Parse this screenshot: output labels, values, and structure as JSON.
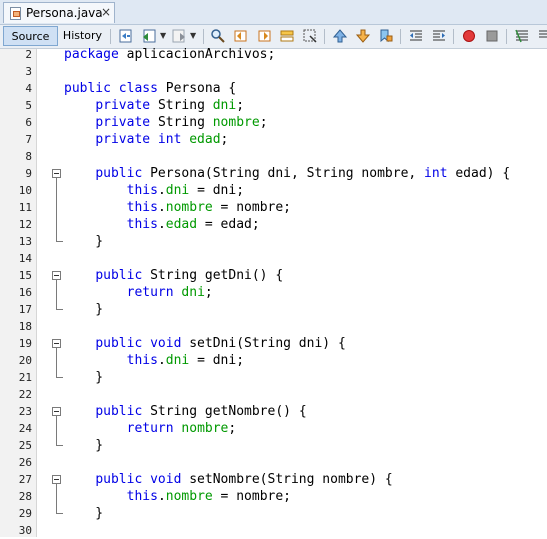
{
  "tab": {
    "title": "Persona.java",
    "close": "×",
    "icon": "java-file-icon"
  },
  "toolbar": {
    "source_label": "Source",
    "history_label": "History",
    "icons": [
      "last-edit-icon",
      "back-icon",
      "forward-icon",
      "find-icon",
      "find-previous-icon",
      "find-next-icon",
      "toggle-highlight-icon",
      "find-selection-icon",
      "previous-bookmark-icon",
      "next-bookmark-icon",
      "toggle-bookmark-icon",
      "shift-left-icon",
      "shift-right-icon",
      "record-macro-icon",
      "stop-macro-icon",
      "comment-icon"
    ]
  },
  "colors": {
    "keyword": "#0000e6",
    "field": "#009900",
    "text": "#000000"
  },
  "lines": [
    {
      "n": "2",
      "tokens": [
        [
          "package ",
          "kw"
        ],
        [
          "aplicacionArchivos;",
          ""
        ]
      ]
    },
    {
      "n": "3",
      "tokens": []
    },
    {
      "n": "4",
      "tokens": [
        [
          "public class ",
          "kw"
        ],
        [
          "Persona {",
          ""
        ]
      ]
    },
    {
      "n": "5",
      "tokens": [
        [
          "    ",
          ""
        ],
        [
          "private ",
          "kw"
        ],
        [
          "String ",
          ""
        ],
        [
          "dni",
          "fd"
        ],
        [
          ";",
          ""
        ]
      ]
    },
    {
      "n": "6",
      "tokens": [
        [
          "    ",
          ""
        ],
        [
          "private ",
          "kw"
        ],
        [
          "String ",
          ""
        ],
        [
          "nombre",
          "fd"
        ],
        [
          ";",
          ""
        ]
      ]
    },
    {
      "n": "7",
      "tokens": [
        [
          "    ",
          ""
        ],
        [
          "private int ",
          "kw"
        ],
        [
          "edad",
          "fd"
        ],
        [
          ";",
          ""
        ]
      ]
    },
    {
      "n": "8",
      "tokens": []
    },
    {
      "n": "9",
      "tokens": [
        [
          "    ",
          ""
        ],
        [
          "public ",
          "kw"
        ],
        [
          "Persona(String dni, String nombre, ",
          ""
        ],
        [
          "int ",
          "kw"
        ],
        [
          "edad) {",
          ""
        ]
      ]
    },
    {
      "n": "10",
      "tokens": [
        [
          "        ",
          ""
        ],
        [
          "this",
          "kw"
        ],
        [
          ".",
          ""
        ],
        [
          "dni",
          "fd"
        ],
        [
          " = dni;",
          ""
        ]
      ]
    },
    {
      "n": "11",
      "tokens": [
        [
          "        ",
          ""
        ],
        [
          "this",
          "kw"
        ],
        [
          ".",
          ""
        ],
        [
          "nombre",
          "fd"
        ],
        [
          " = nombre;",
          ""
        ]
      ]
    },
    {
      "n": "12",
      "tokens": [
        [
          "        ",
          ""
        ],
        [
          "this",
          "kw"
        ],
        [
          ".",
          ""
        ],
        [
          "edad",
          "fd"
        ],
        [
          " = edad;",
          ""
        ]
      ]
    },
    {
      "n": "13",
      "tokens": [
        [
          "    }",
          ""
        ]
      ]
    },
    {
      "n": "14",
      "tokens": []
    },
    {
      "n": "15",
      "tokens": [
        [
          "    ",
          ""
        ],
        [
          "public ",
          "kw"
        ],
        [
          "String getDni() {",
          ""
        ]
      ]
    },
    {
      "n": "16",
      "tokens": [
        [
          "        ",
          ""
        ],
        [
          "return ",
          "kw"
        ],
        [
          "dni",
          "fd"
        ],
        [
          ";",
          ""
        ]
      ]
    },
    {
      "n": "17",
      "tokens": [
        [
          "    }",
          ""
        ]
      ]
    },
    {
      "n": "18",
      "tokens": []
    },
    {
      "n": "19",
      "tokens": [
        [
          "    ",
          ""
        ],
        [
          "public void ",
          "kw"
        ],
        [
          "setDni(String dni) {",
          ""
        ]
      ]
    },
    {
      "n": "20",
      "tokens": [
        [
          "        ",
          ""
        ],
        [
          "this",
          "kw"
        ],
        [
          ".",
          ""
        ],
        [
          "dni",
          "fd"
        ],
        [
          " = dni;",
          ""
        ]
      ]
    },
    {
      "n": "21",
      "tokens": [
        [
          "    }",
          ""
        ]
      ]
    },
    {
      "n": "22",
      "tokens": []
    },
    {
      "n": "23",
      "tokens": [
        [
          "    ",
          ""
        ],
        [
          "public ",
          "kw"
        ],
        [
          "String getNombre() {",
          ""
        ]
      ]
    },
    {
      "n": "24",
      "tokens": [
        [
          "        ",
          ""
        ],
        [
          "return ",
          "kw"
        ],
        [
          "nombre",
          "fd"
        ],
        [
          ";",
          ""
        ]
      ]
    },
    {
      "n": "25",
      "tokens": [
        [
          "    }",
          ""
        ]
      ]
    },
    {
      "n": "26",
      "tokens": []
    },
    {
      "n": "27",
      "tokens": [
        [
          "    ",
          ""
        ],
        [
          "public void ",
          "kw"
        ],
        [
          "setNombre(String nombre) {",
          ""
        ]
      ]
    },
    {
      "n": "28",
      "tokens": [
        [
          "        ",
          ""
        ],
        [
          "this",
          "kw"
        ],
        [
          ".",
          ""
        ],
        [
          "nombre",
          "fd"
        ],
        [
          " = nombre;",
          ""
        ]
      ]
    },
    {
      "n": "29",
      "tokens": [
        [
          "    }",
          ""
        ]
      ]
    },
    {
      "n": "30",
      "tokens": []
    }
  ],
  "folds": [
    {
      "start": "9",
      "end": "13"
    },
    {
      "start": "15",
      "end": "17"
    },
    {
      "start": "19",
      "end": "21"
    },
    {
      "start": "23",
      "end": "25"
    },
    {
      "start": "27",
      "end": "29"
    }
  ]
}
